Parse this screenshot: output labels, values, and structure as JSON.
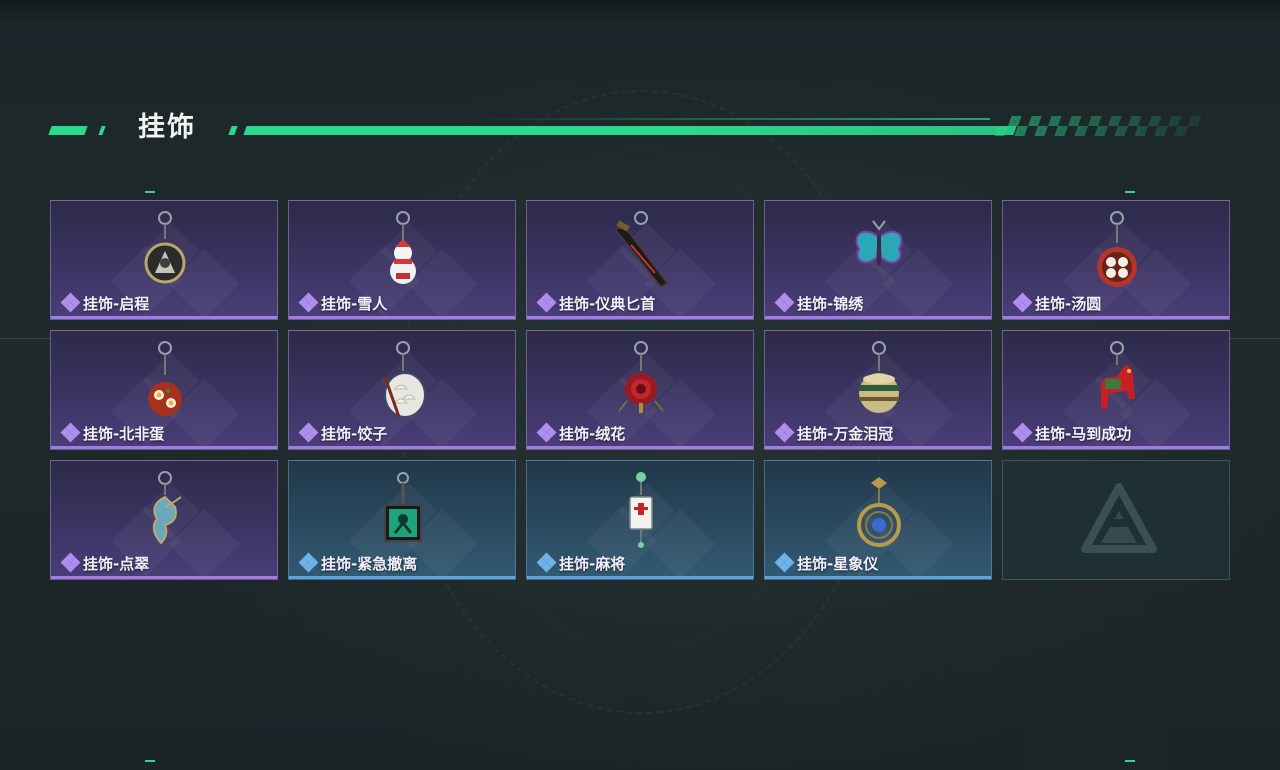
{
  "header": {
    "title": "挂饰"
  },
  "items": [
    {
      "label": "挂饰-启程",
      "rarity": "purple",
      "icon": "compass-ring-charm-icon"
    },
    {
      "label": "挂饰-雪人",
      "rarity": "purple",
      "icon": "snowman-charm-icon"
    },
    {
      "label": "挂饰-仪典匕首",
      "rarity": "purple",
      "icon": "dagger-charm-icon"
    },
    {
      "label": "挂饰-锦绣",
      "rarity": "purple",
      "icon": "butterfly-charm-icon"
    },
    {
      "label": "挂饰-汤圆",
      "rarity": "purple",
      "icon": "rice-ball-bowl-charm-icon"
    },
    {
      "label": "挂饰-北非蛋",
      "rarity": "purple",
      "icon": "shakshuka-pan-charm-icon"
    },
    {
      "label": "挂饰-饺子",
      "rarity": "purple",
      "icon": "dumpling-plate-charm-icon"
    },
    {
      "label": "挂饰-绒花",
      "rarity": "purple",
      "icon": "velvet-flower-charm-icon"
    },
    {
      "label": "挂饰-万金泪冠",
      "rarity": "purple",
      "icon": "crown-box-charm-icon"
    },
    {
      "label": "挂饰-马到成功",
      "rarity": "purple",
      "icon": "red-horse-charm-icon"
    },
    {
      "label": "挂饰-点翠",
      "rarity": "purple",
      "icon": "kingfisher-ornament-charm-icon"
    },
    {
      "label": "挂饰-紧急撤离",
      "rarity": "blue",
      "icon": "emergency-sign-charm-icon"
    },
    {
      "label": "挂饰-麻将",
      "rarity": "blue",
      "icon": "mahjong-tile-charm-icon"
    },
    {
      "label": "挂饰-星象仪",
      "rarity": "blue",
      "icon": "astrolabe-charm-icon"
    }
  ],
  "colors": {
    "accent_green": "#2bd98c",
    "rarity_purple": "#a27be6",
    "rarity_blue": "#5fa3de"
  }
}
